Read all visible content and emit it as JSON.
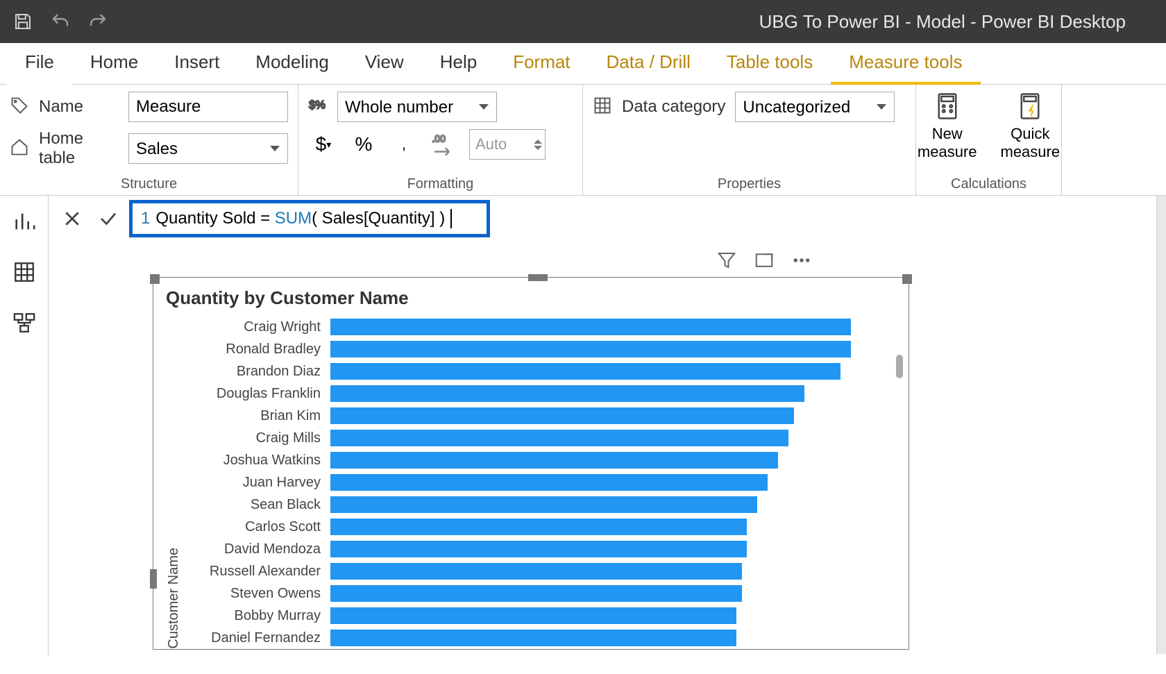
{
  "titlebar": {
    "title": "UBG To Power BI - Model - Power BI Desktop"
  },
  "menu": {
    "file": "File",
    "home": "Home",
    "insert": "Insert",
    "modeling": "Modeling",
    "view": "View",
    "help": "Help",
    "format": "Format",
    "data_drill": "Data / Drill",
    "table_tools": "Table tools",
    "measure_tools": "Measure tools"
  },
  "ribbon": {
    "structure": {
      "name_label": "Name",
      "name_value": "Measure",
      "home_table_label": "Home table",
      "home_table_value": "Sales",
      "footer": "Structure"
    },
    "formatting": {
      "format_value": "Whole number",
      "decimals_placeholder": "Auto",
      "footer": "Formatting"
    },
    "properties": {
      "category_label": "Data category",
      "category_value": "Uncategorized",
      "footer": "Properties"
    },
    "calculations": {
      "new_measure": "New\nmeasure",
      "quick_measure": "Quick\nmeasure",
      "footer": "Calculations"
    }
  },
  "formula": {
    "line_no": "1",
    "text_pre": "Quantity Sold = ",
    "fn": "SUM",
    "text_args": "( Sales[Quantity] )"
  },
  "chart_data": {
    "type": "bar",
    "title": "Quantity by Customer Name",
    "ylabel": "Customer Name",
    "xlabel": "",
    "categories": [
      "Craig Wright",
      "Ronald Bradley",
      "Brandon Diaz",
      "Douglas Franklin",
      "Brian Kim",
      "Craig Mills",
      "Joshua Watkins",
      "Juan Harvey",
      "Sean Black",
      "Carlos Scott",
      "David Mendoza",
      "Russell Alexander",
      "Steven Owens",
      "Bobby Murray",
      "Daniel Fernandez"
    ],
    "values": [
      100,
      100,
      98,
      91,
      89,
      88,
      86,
      84,
      82,
      80,
      80,
      79,
      79,
      78,
      78
    ],
    "ylim": [
      0,
      100
    ]
  }
}
